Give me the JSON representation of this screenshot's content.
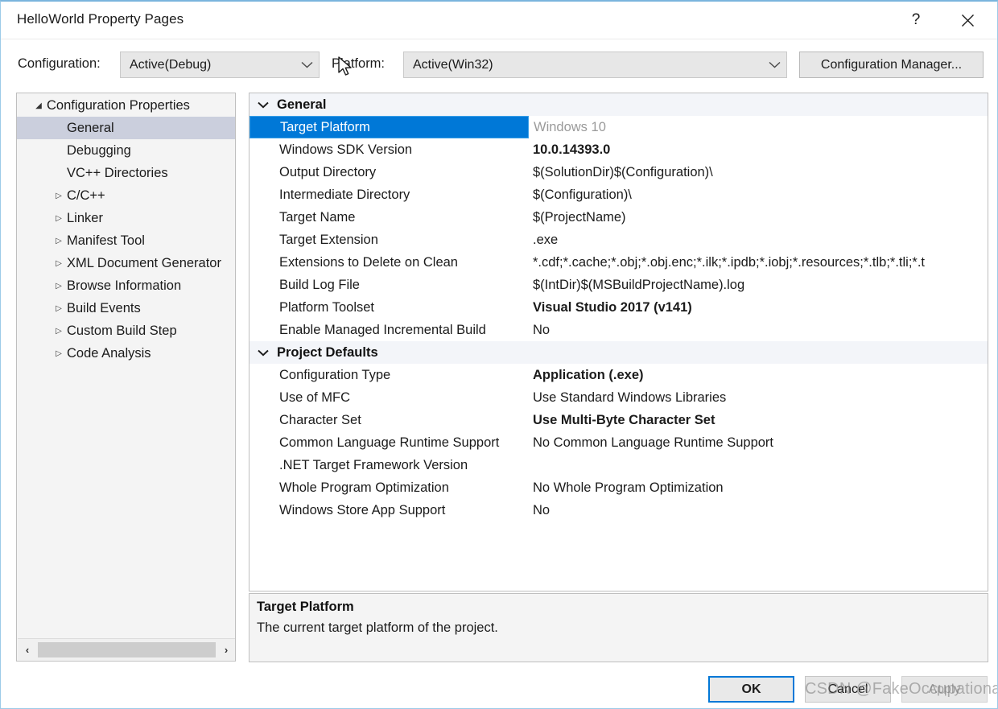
{
  "window": {
    "title": "HelloWorld Property Pages",
    "help_glyph": "?",
    "close_glyph": "✕"
  },
  "configbar": {
    "configuration_label": "Configuration:",
    "configuration_value": "Active(Debug)",
    "platform_label": "Platform:",
    "platform_value": "Active(Win32)",
    "configuration_manager_label": "Configuration Manager..."
  },
  "tree": {
    "items": [
      {
        "label": "Configuration Properties",
        "depth": 0,
        "glyph": "◢",
        "selected": false
      },
      {
        "label": "General",
        "depth": 1,
        "glyph": "",
        "selected": true
      },
      {
        "label": "Debugging",
        "depth": 1,
        "glyph": "",
        "selected": false
      },
      {
        "label": "VC++ Directories",
        "depth": 1,
        "glyph": "",
        "selected": false
      },
      {
        "label": "C/C++",
        "depth": 1,
        "glyph": "▷",
        "selected": false
      },
      {
        "label": "Linker",
        "depth": 1,
        "glyph": "▷",
        "selected": false
      },
      {
        "label": "Manifest Tool",
        "depth": 1,
        "glyph": "▷",
        "selected": false
      },
      {
        "label": "XML Document Generator",
        "depth": 1,
        "glyph": "▷",
        "selected": false
      },
      {
        "label": "Browse Information",
        "depth": 1,
        "glyph": "▷",
        "selected": false
      },
      {
        "label": "Build Events",
        "depth": 1,
        "glyph": "▷",
        "selected": false
      },
      {
        "label": "Custom Build Step",
        "depth": 1,
        "glyph": "▷",
        "selected": false
      },
      {
        "label": "Code Analysis",
        "depth": 1,
        "glyph": "▷",
        "selected": false
      }
    ],
    "scroll_left_glyph": "‹",
    "scroll_right_glyph": "›"
  },
  "grid": {
    "groups": [
      {
        "label": "General",
        "expanded": true,
        "rows": [
          {
            "name": "Target Platform",
            "value": "Windows 10",
            "bold": false,
            "selected": true
          },
          {
            "name": "Windows SDK Version",
            "value": "10.0.14393.0",
            "bold": true,
            "selected": false
          },
          {
            "name": "Output Directory",
            "value": "$(SolutionDir)$(Configuration)\\",
            "bold": false,
            "selected": false
          },
          {
            "name": "Intermediate Directory",
            "value": "$(Configuration)\\",
            "bold": false,
            "selected": false
          },
          {
            "name": "Target Name",
            "value": "$(ProjectName)",
            "bold": false,
            "selected": false
          },
          {
            "name": "Target Extension",
            "value": ".exe",
            "bold": false,
            "selected": false
          },
          {
            "name": "Extensions to Delete on Clean",
            "value": "*.cdf;*.cache;*.obj;*.obj.enc;*.ilk;*.ipdb;*.iobj;*.resources;*.tlb;*.tli;*.t",
            "bold": false,
            "selected": false
          },
          {
            "name": "Build Log File",
            "value": "$(IntDir)$(MSBuildProjectName).log",
            "bold": false,
            "selected": false
          },
          {
            "name": "Platform Toolset",
            "value": "Visual Studio 2017 (v141)",
            "bold": true,
            "selected": false
          },
          {
            "name": "Enable Managed Incremental Build",
            "value": "No",
            "bold": false,
            "selected": false
          }
        ]
      },
      {
        "label": "Project Defaults",
        "expanded": true,
        "rows": [
          {
            "name": "Configuration Type",
            "value": "Application (.exe)",
            "bold": true,
            "selected": false
          },
          {
            "name": "Use of MFC",
            "value": "Use Standard Windows Libraries",
            "bold": false,
            "selected": false
          },
          {
            "name": "Character Set",
            "value": "Use Multi-Byte Character Set",
            "bold": true,
            "selected": false
          },
          {
            "name": "Common Language Runtime Support",
            "value": "No Common Language Runtime Support",
            "bold": false,
            "selected": false
          },
          {
            "name": ".NET Target Framework Version",
            "value": "",
            "bold": false,
            "selected": false
          },
          {
            "name": "Whole Program Optimization",
            "value": "No Whole Program Optimization",
            "bold": false,
            "selected": false
          },
          {
            "name": "Windows Store App Support",
            "value": "No",
            "bold": false,
            "selected": false
          }
        ]
      }
    ]
  },
  "description": {
    "title": "Target Platform",
    "body": "The current target platform of the project."
  },
  "footer": {
    "ok_label": "OK",
    "cancel_label": "Cancel",
    "apply_label": "Apply"
  },
  "watermark": {
    "text": "CSDN @FakeOccupational"
  },
  "colors": {
    "selection_blue": "#0078d7",
    "tree_selection": "#cbcfdd",
    "group_header_bg": "#f3f5f9",
    "panel_border": "#bfbfbf",
    "window_border": "#9ccbe8"
  }
}
